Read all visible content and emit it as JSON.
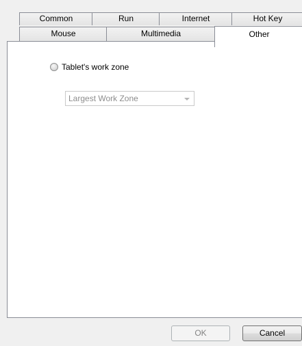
{
  "tabs": {
    "row1": [
      {
        "label": "Common"
      },
      {
        "label": "Run"
      },
      {
        "label": "Internet"
      },
      {
        "label": "Hot Key"
      }
    ],
    "row2": [
      {
        "label": "Mouse"
      },
      {
        "label": "Multimedia"
      },
      {
        "label": "Other"
      }
    ],
    "selected": "Other"
  },
  "panel": {
    "radio_label": "Tablet's work zone",
    "radio_checked": false,
    "combo_value": "Largest Work Zone"
  },
  "buttons": {
    "ok_label": "OK",
    "cancel_label": "Cancel"
  }
}
